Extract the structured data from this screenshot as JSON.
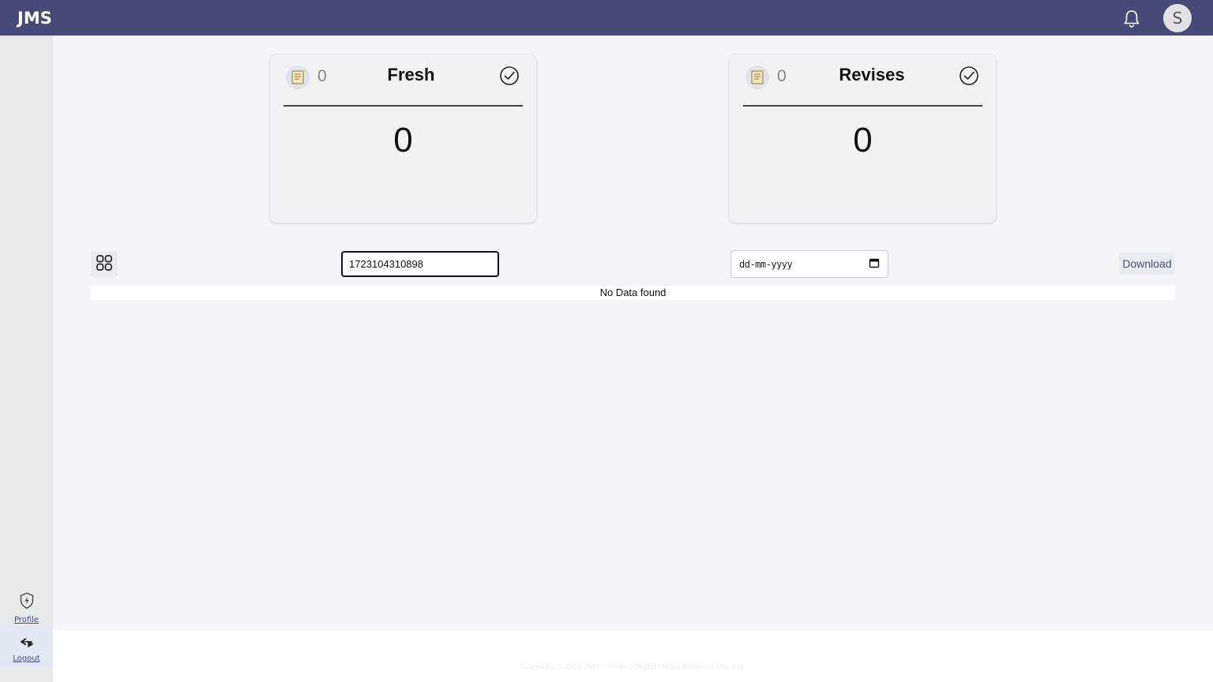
{
  "header": {
    "brand": "JMS",
    "avatar_initial": "S",
    "bar_color": "#474a78",
    "icons": [
      "bell-icon"
    ]
  },
  "sidebar": {
    "items": [
      {
        "label": "Profile",
        "icon": "shield-bolt-icon"
      },
      {
        "label": "Logout",
        "icon": "logout-arrow-icon"
      }
    ]
  },
  "cards": [
    {
      "title": "Fresh",
      "count": "0",
      "value": "0",
      "icon": "document-icon",
      "action_icon": "check-circle-icon"
    },
    {
      "title": "Revises",
      "count": "0",
      "value": "0",
      "icon": "document-icon",
      "action_icon": "check-circle-icon"
    }
  ],
  "toolbar": {
    "search_value": "1723104310898",
    "date_placeholder": "dd-mm-yyyy",
    "download_label": "Download",
    "grid_icon": "grid-icon"
  },
  "table": {
    "empty_message": "No Data found"
  },
  "footer": {
    "text": "Copyright © 2024 JMS - Perfect Digital Media Solutions Pvt. Ltd."
  }
}
